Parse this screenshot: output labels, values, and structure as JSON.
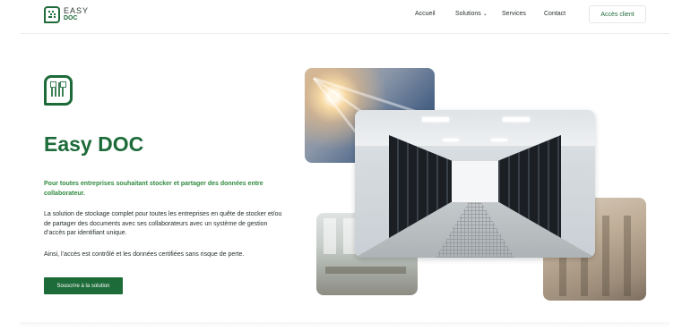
{
  "brand": {
    "name_line1": "EASY",
    "name_line2": "DOC"
  },
  "nav": {
    "items": [
      "Accueil",
      "Solutions",
      "Services",
      "Contact"
    ],
    "client_button": "Accès client"
  },
  "hero": {
    "title": "Easy DOC",
    "tagline": "Pour toutes entreprises souhaitant stocker et partager des données entre collaborateur.",
    "description": "La solution de stockage complet pour toutes les entreprises en quête de stocker et/ou de partager des documents avec ses collaborateurs avec un système de gestion d’accès par identifiant unique.",
    "description2": "Ainsi, l’accès est contrôlé et les données certifiées sans risque de perte.",
    "cta": "Souscrire à la solution"
  },
  "colors": {
    "brand_green": "#1e6b3a",
    "accent_green": "#2f8a3e"
  },
  "icons": {
    "logo": "qr-code-chat-icon",
    "hero": "qr-code-chat-icon",
    "dropdown": "chevron-down-icon"
  }
}
